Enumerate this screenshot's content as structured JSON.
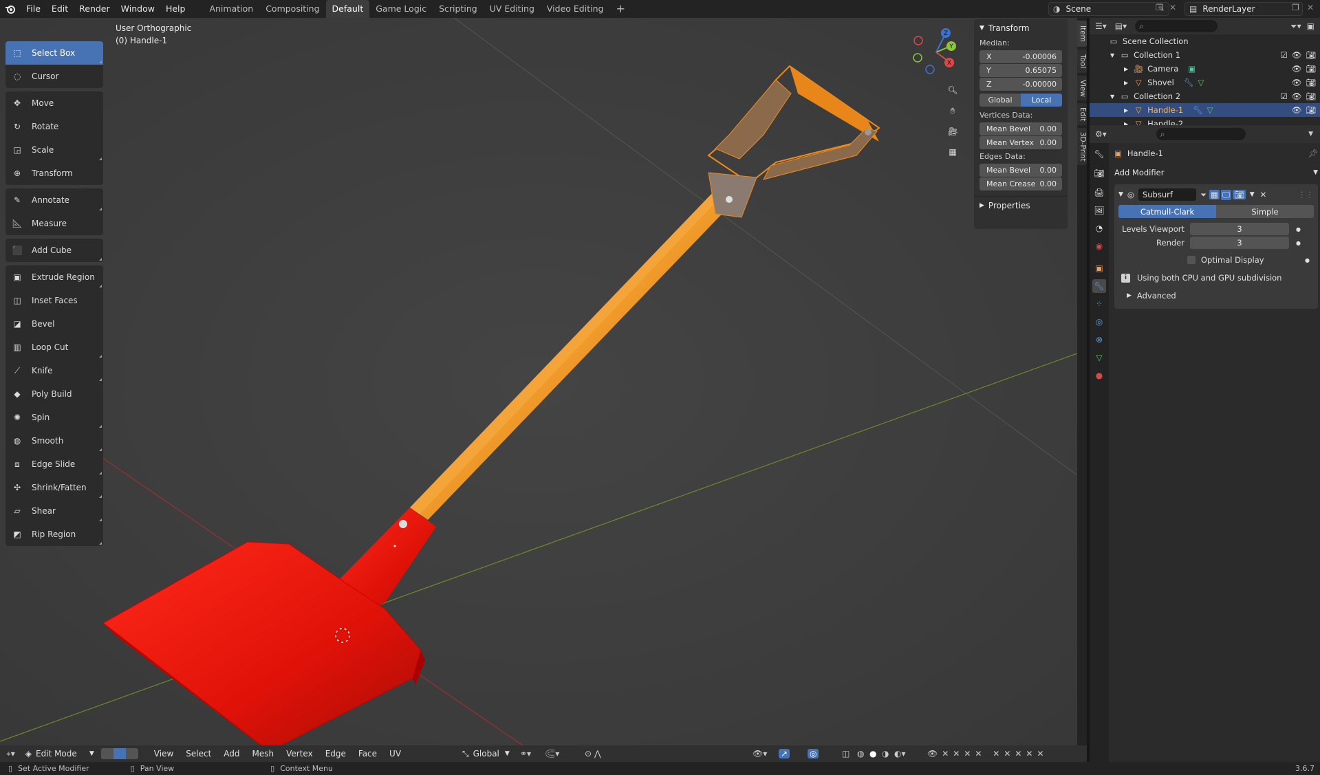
{
  "topbar": {
    "menus": [
      "File",
      "Edit",
      "Render",
      "Window",
      "Help"
    ],
    "workspaces": [
      "Animation",
      "Compositing",
      "Default",
      "Game Logic",
      "Scripting",
      "UV Editing",
      "Video Editing"
    ],
    "active_workspace": "Default",
    "add_workspace": "+",
    "scene": "Scene",
    "view_layer": "RenderLayer"
  },
  "viewport": {
    "view_name": "User Orthographic",
    "object_label": "(0) Handle-1",
    "gizmo_axes": [
      "X",
      "Y",
      "Z"
    ]
  },
  "toolbar": {
    "groups": [
      [
        "Select Box",
        "Cursor"
      ],
      [
        "Move",
        "Rotate",
        "Scale",
        "Transform"
      ],
      [
        "Annotate",
        "Measure"
      ],
      [
        "Add Cube"
      ],
      [
        "Extrude Region",
        "Inset Faces",
        "Bevel",
        "Loop Cut",
        "Knife",
        "Poly Build",
        "Spin",
        "Smooth",
        "Edge Slide",
        "Shrink/Fatten",
        "Shear",
        "Rip Region"
      ]
    ],
    "active": "Select Box"
  },
  "npanel": {
    "title": "Transform",
    "median_label": "Median:",
    "x": {
      "label": "X",
      "value": "-0.00006"
    },
    "y": {
      "label": "Y",
      "value": "0.65075"
    },
    "z": {
      "label": "Z",
      "value": "-0.00000"
    },
    "global": "Global",
    "local": "Local",
    "vertices_label": "Vertices Data:",
    "mean_bevel_v": {
      "label": "Mean Bevel",
      "value": "0.00"
    },
    "mean_vertex": {
      "label": "Mean Vertex",
      "value": "0.00"
    },
    "edges_label": "Edges Data:",
    "mean_bevel_e": {
      "label": "Mean Bevel",
      "value": "0.00"
    },
    "mean_crease": {
      "label": "Mean Crease",
      "value": "0.00"
    },
    "properties": "Properties",
    "side_tabs": [
      "Item",
      "Tool",
      "View",
      "Edit",
      "3D-Print"
    ]
  },
  "viewport_header": {
    "mode": "Edit Mode",
    "menus": [
      "View",
      "Select",
      "Add",
      "Mesh",
      "Vertex",
      "Edge",
      "Face",
      "UV"
    ],
    "orientation": "Global"
  },
  "statusbar": {
    "left": "Set Active Modifier",
    "middle": "Pan View",
    "right": "Context Menu",
    "version": "3.6.7"
  },
  "outliner": {
    "rows": [
      {
        "label": "Scene Collection",
        "indent": 0
      },
      {
        "label": "Collection 1",
        "indent": 1
      },
      {
        "label": "Camera",
        "indent": 2
      },
      {
        "label": "Shovel",
        "indent": 2
      },
      {
        "label": "Collection 2",
        "indent": 1
      },
      {
        "label": "Handle-1",
        "indent": 2,
        "selected": true
      },
      {
        "label": "Handle-2",
        "indent": 2
      }
    ]
  },
  "properties": {
    "object_name": "Handle-1",
    "add_modifier": "Add Modifier",
    "modifier_name": "Subsurf",
    "catmull_clark": "Catmull-Clark",
    "simple": "Simple",
    "levels_viewport_label": "Levels Viewport",
    "levels_viewport_value": "3",
    "render_label": "Render",
    "render_value": "3",
    "optimal_display": "Optimal Display",
    "info": "Using both CPU and GPU subdivision",
    "advanced": "Advanced"
  }
}
